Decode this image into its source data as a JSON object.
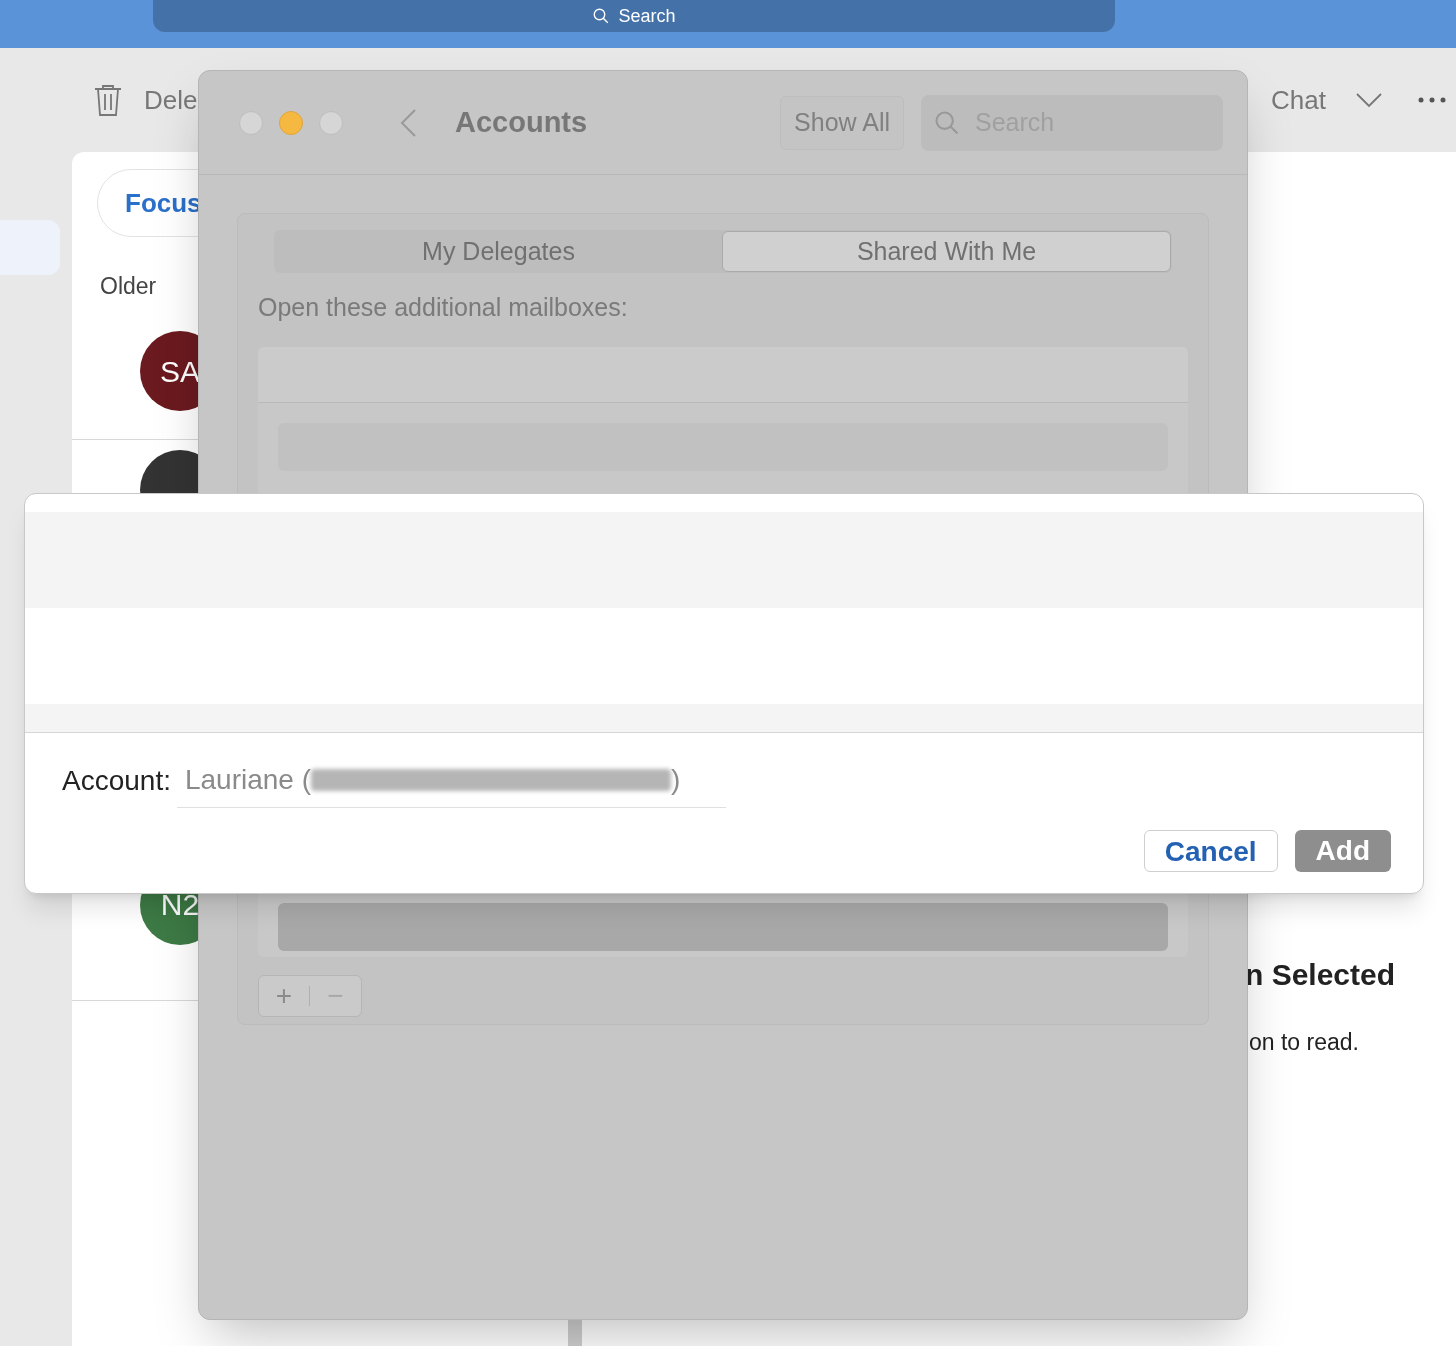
{
  "top_bar": {
    "search": {
      "placeholder": "Search"
    }
  },
  "toolbar": {
    "delete_label": "Dele",
    "chat_label": "Chat"
  },
  "message_list": {
    "focus_tab": "Focus",
    "group_label": "Older",
    "avatars": [
      {
        "initials": "SA",
        "color": "#6b1a1f"
      },
      {
        "color": "#333333"
      },
      {
        "initials": "N2",
        "color": "#3d7a45"
      }
    ]
  },
  "reading_pane": {
    "title": "n Selected",
    "hint": "on to read."
  },
  "preferences_window": {
    "title": "Accounts",
    "show_all": "Show All",
    "search": {
      "placeholder": "Search"
    },
    "tabs": [
      {
        "label": "My Delegates",
        "selected": false
      },
      {
        "label": "Shared With Me",
        "selected": true
      }
    ],
    "list_label": "Open these additional mailboxes:",
    "add_symbol": "+",
    "remove_symbol": "−"
  },
  "sheet": {
    "account_label": "Account:",
    "account_prefix": "Lauriane (",
    "account_suffix": ")",
    "account_redacted": true,
    "buttons": [
      {
        "label": "Cancel",
        "kind": "secondary"
      },
      {
        "label": "Add",
        "kind": "primary"
      }
    ]
  }
}
